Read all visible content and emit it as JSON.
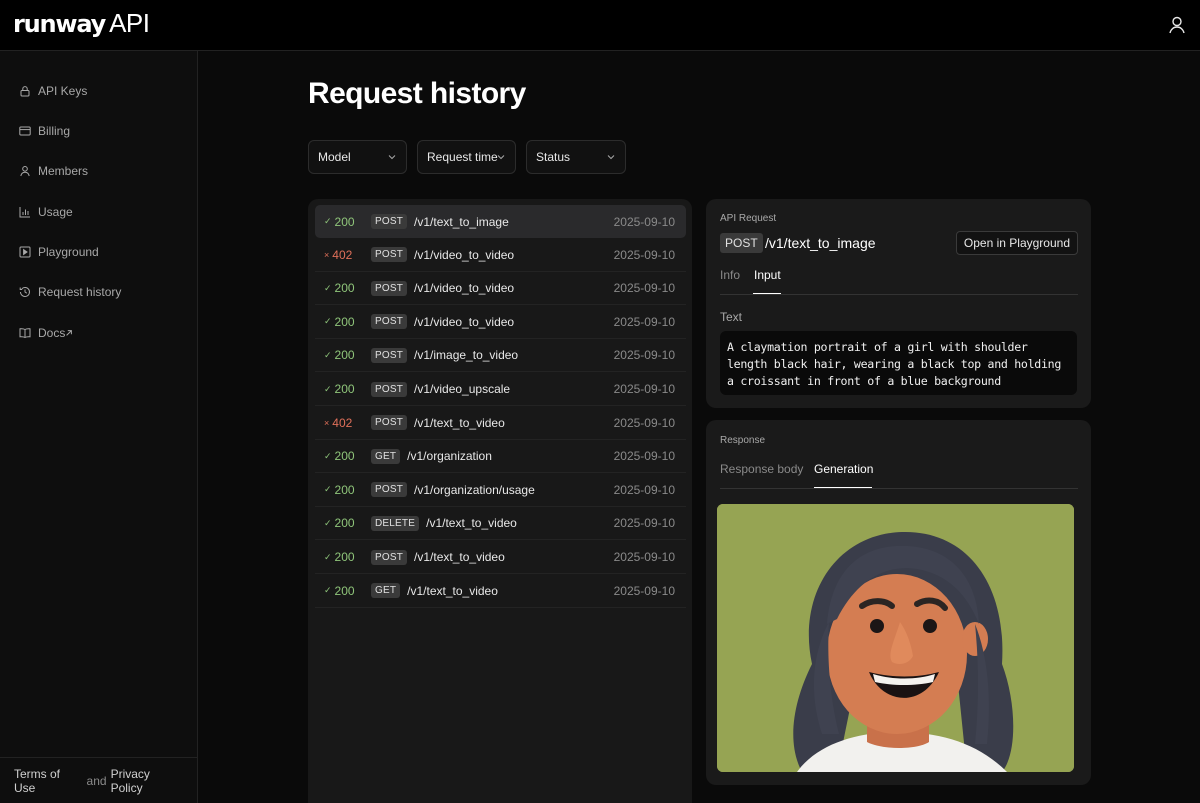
{
  "app": {
    "logo_word": "runway",
    "logo_suffix": "API"
  },
  "sidebar": {
    "items": [
      {
        "label": "API Keys",
        "icon": "lock-icon"
      },
      {
        "label": "Billing",
        "icon": "credit-card-icon"
      },
      {
        "label": "Members",
        "icon": "user-icon"
      },
      {
        "label": "Usage",
        "icon": "bar-chart-icon"
      },
      {
        "label": "Playground",
        "icon": "play-square-icon"
      },
      {
        "label": "Request history",
        "icon": "history-icon"
      },
      {
        "label": "Docs",
        "icon": "book-icon",
        "external": true
      }
    ],
    "footer": {
      "terms": "Terms of Use",
      "and": "and",
      "privacy": "Privacy Policy"
    }
  },
  "main": {
    "title": "Request history",
    "filters": [
      "Model",
      "Request time",
      "Status"
    ],
    "requests": [
      {
        "status": "200",
        "ok": true,
        "method": "POST",
        "path": "/v1/text_to_image",
        "date": "2025-09-10",
        "selected": true
      },
      {
        "status": "402",
        "ok": false,
        "method": "POST",
        "path": "/v1/video_to_video",
        "date": "2025-09-10"
      },
      {
        "status": "200",
        "ok": true,
        "method": "POST",
        "path": "/v1/video_to_video",
        "date": "2025-09-10"
      },
      {
        "status": "200",
        "ok": true,
        "method": "POST",
        "path": "/v1/video_to_video",
        "date": "2025-09-10"
      },
      {
        "status": "200",
        "ok": true,
        "method": "POST",
        "path": "/v1/image_to_video",
        "date": "2025-09-10"
      },
      {
        "status": "200",
        "ok": true,
        "method": "POST",
        "path": "/v1/video_upscale",
        "date": "2025-09-10"
      },
      {
        "status": "402",
        "ok": false,
        "method": "POST",
        "path": "/v1/text_to_video",
        "date": "2025-09-10"
      },
      {
        "status": "200",
        "ok": true,
        "method": "GET",
        "path": "/v1/organization",
        "date": "2025-09-10"
      },
      {
        "status": "200",
        "ok": true,
        "method": "POST",
        "path": "/v1/organization/usage",
        "date": "2025-09-10"
      },
      {
        "status": "200",
        "ok": true,
        "method": "DELETE",
        "path": "/v1/text_to_video",
        "date": "2025-09-10"
      },
      {
        "status": "200",
        "ok": true,
        "method": "POST",
        "path": "/v1/text_to_video",
        "date": "2025-09-10"
      },
      {
        "status": "200",
        "ok": true,
        "method": "GET",
        "path": "/v1/text_to_video",
        "date": "2025-09-10"
      }
    ]
  },
  "detail": {
    "request_label": "API Request",
    "method": "POST",
    "path": "/v1/text_to_image",
    "open_button": "Open in Playground",
    "request_tabs": {
      "info": "Info",
      "input": "Input"
    },
    "text_label": "Text",
    "prompt": "A claymation portrait of a girl with shoulder length black hair, wearing a black top and holding a croissant in front of a blue background",
    "response_label": "Response",
    "response_tabs": {
      "body": "Response body",
      "generation": "Generation"
    }
  },
  "colors": {
    "success": "#8fc57a",
    "error": "#e0705a",
    "image_bg": "#96a453"
  }
}
